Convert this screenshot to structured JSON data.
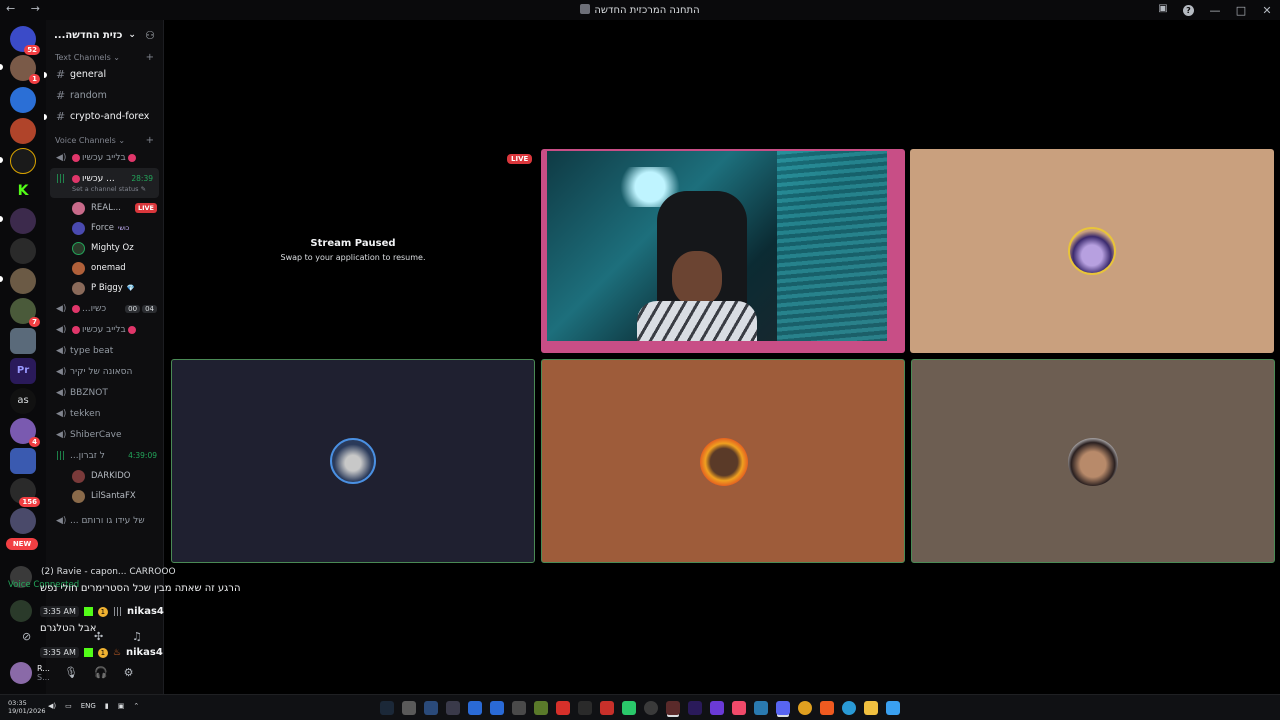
{
  "titlebar": {
    "title": "התחנה המרכזית החדשה",
    "nav_label": "← →"
  },
  "rail": {
    "badges": [
      "52",
      "1",
      "7",
      "4",
      "156"
    ],
    "new_label": "NEW",
    "as_label": "as",
    "pr_label": "Pr"
  },
  "sidebar": {
    "server_name": "...כזית החדשה",
    "text_category": "Text Channels",
    "voice_category": "Voice Channels",
    "text_channels": [
      "general",
      "random",
      "crypto-and-forex"
    ],
    "voice": {
      "c1": "בלייב עכשיו",
      "active_name": "עכשיו ...",
      "active_time": "28:39",
      "active_status": "Set a channel status",
      "members": [
        {
          "name": "REAL...",
          "tag": "LIVE"
        },
        {
          "name": "Force",
          "tag": "כושי"
        },
        {
          "name": "Mighty Oz",
          "tag": ""
        },
        {
          "name": "onemad",
          "tag": ""
        },
        {
          "name": "P Biggy",
          "tag": "💎"
        }
      ],
      "c3": "...כשיו",
      "c3_pills": [
        "00",
        "04"
      ],
      "c4": "בלייב עכשיו",
      "c5": "type beat",
      "c6": "הסאונה של יקיר",
      "c7": "BBZNOT",
      "c8": "tekken",
      "c9": "ShiberCave",
      "c10": "...ל זברון",
      "c10_time": "4:39:09",
      "c10_members": [
        "DARKIDO",
        "LilSantaFX"
      ],
      "c11": "... של עידו גו ורותם"
    }
  },
  "panel": {
    "voice_connected": "Voice Connected",
    "user_name": "R...",
    "user_sub": "S..."
  },
  "stage": {
    "stream_paused_title": "Stream Paused",
    "stream_paused_sub": "Swap to your application to resume.",
    "live_label": "LIVE",
    "tile_colors": {
      "tan": "#c9a07e",
      "navy": "#1f2030",
      "brown": "#9e5c3a",
      "taupe": "#6d5e52",
      "speaking": "#c84e86"
    }
  },
  "overlay": {
    "top_line": "(2) Ravie - capon... CARROOO",
    "msg1": "הרגע זה שאתה מבין שכל הסטרימרים חולי נפש",
    "time1": "3:35 AM",
    "nick1": "nikas4",
    "msg2": "אבל הטלגרם",
    "time2": "3:35 AM",
    "nick2": "nikas4"
  },
  "taskbar": {
    "time": "03:35",
    "date": "19/01/2026",
    "lang": "ENG"
  }
}
